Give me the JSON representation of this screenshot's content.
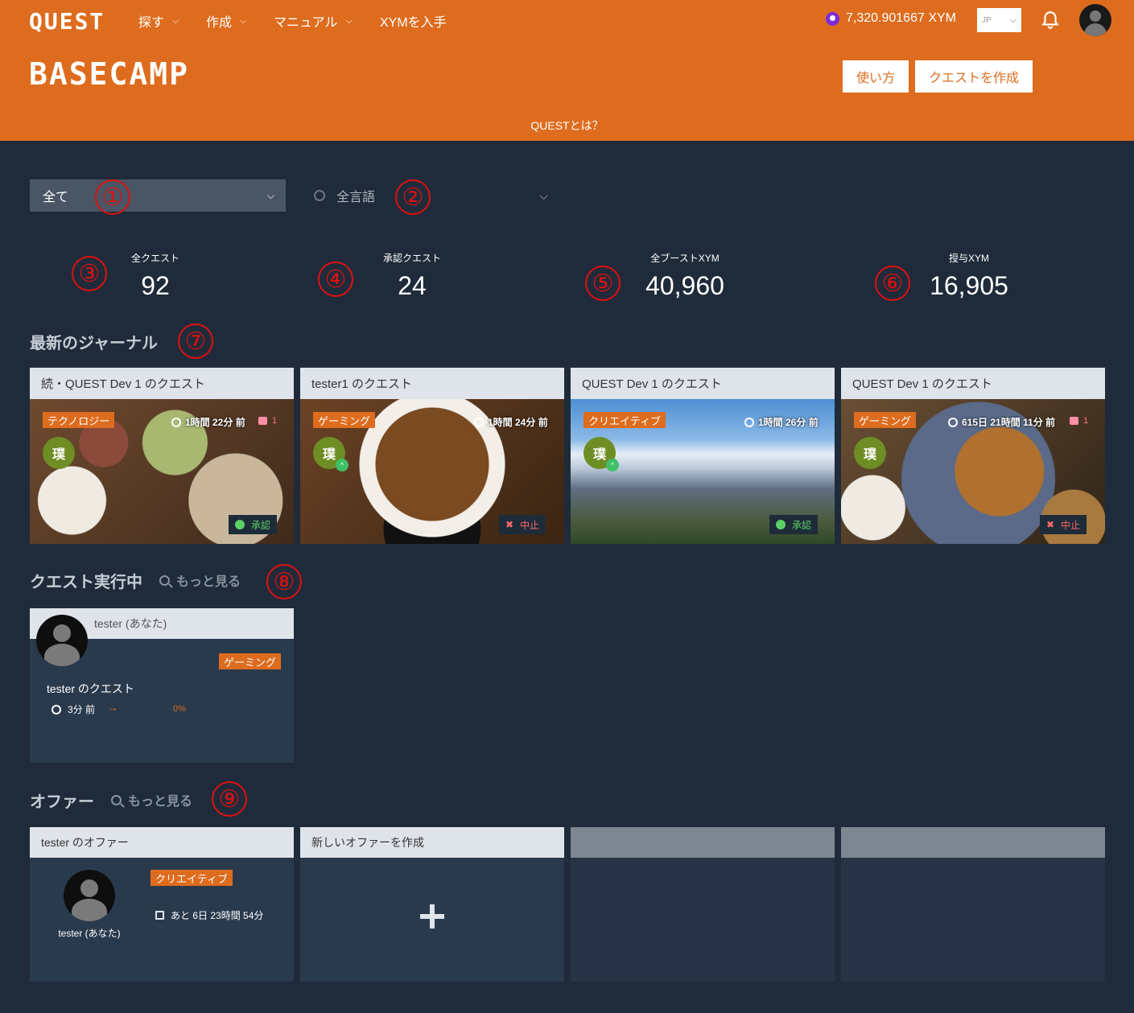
{
  "header": {
    "logo": "QUEST",
    "nav": [
      {
        "label": "探す"
      },
      {
        "label": "作成"
      },
      {
        "label": "マニュアル"
      },
      {
        "label": "XYMを入手"
      }
    ],
    "balance": "7,320.901667 XYM",
    "lang": "JP",
    "title": "BASECAMP",
    "how_to_label": "使い方",
    "create_quest_label": "クエストを作成",
    "what_is_quest": "QUESTとは？",
    "accent_color": "#de6c1e"
  },
  "filters": {
    "category": "全て",
    "language": "全言語"
  },
  "annotations": [
    "①",
    "②",
    "③",
    "④",
    "⑤",
    "⑥",
    "⑦",
    "⑧",
    "⑨"
  ],
  "stats": [
    {
      "label": "全クエスト",
      "value": "92"
    },
    {
      "label": "承認クエスト",
      "value": "24"
    },
    {
      "label": "全ブーストXYM",
      "value": "40,960"
    },
    {
      "label": "授与XYM",
      "value": "16,905"
    }
  ],
  "journal": {
    "title": "最新のジャーナル",
    "cards": [
      {
        "title": "続・QUEST Dev 1 のクエスト",
        "tag": "テクノロジー",
        "time": "1時間 22分 前",
        "likes": "1",
        "status": "承認",
        "status_type": "ok"
      },
      {
        "title": "tester1 のクエスト",
        "tag": "ゲーミング",
        "time": "1時間 24分 前",
        "likes": "",
        "status": "中止",
        "status_type": "ng"
      },
      {
        "title": "QUEST Dev 1 のクエスト",
        "tag": "クリエイティブ",
        "time": "1時間 26分 前",
        "likes": "",
        "status": "承認",
        "status_type": "ok"
      },
      {
        "title": "QUEST Dev 1 のクエスト",
        "tag": "ゲーミング",
        "time": "615日 21時間 11分 前",
        "likes": "1",
        "status": "中止",
        "status_type": "ng"
      }
    ],
    "logo_text": "璞"
  },
  "running": {
    "title": "クエスト実行中",
    "more": "もっと見る",
    "card": {
      "user": "tester (あなた)",
      "tag": "ゲーミング",
      "quest": "tester のクエスト",
      "time": "3分 前",
      "progress": "0%"
    }
  },
  "offers": {
    "title": "オファー",
    "more": "もっと見る",
    "card1": {
      "title": "tester のオファー",
      "tag": "クリエイティブ",
      "remaining": "あと 6日 23時間 54分",
      "user": "tester (あなた)"
    },
    "card2": {
      "title": "新しいオファーを作成"
    }
  }
}
